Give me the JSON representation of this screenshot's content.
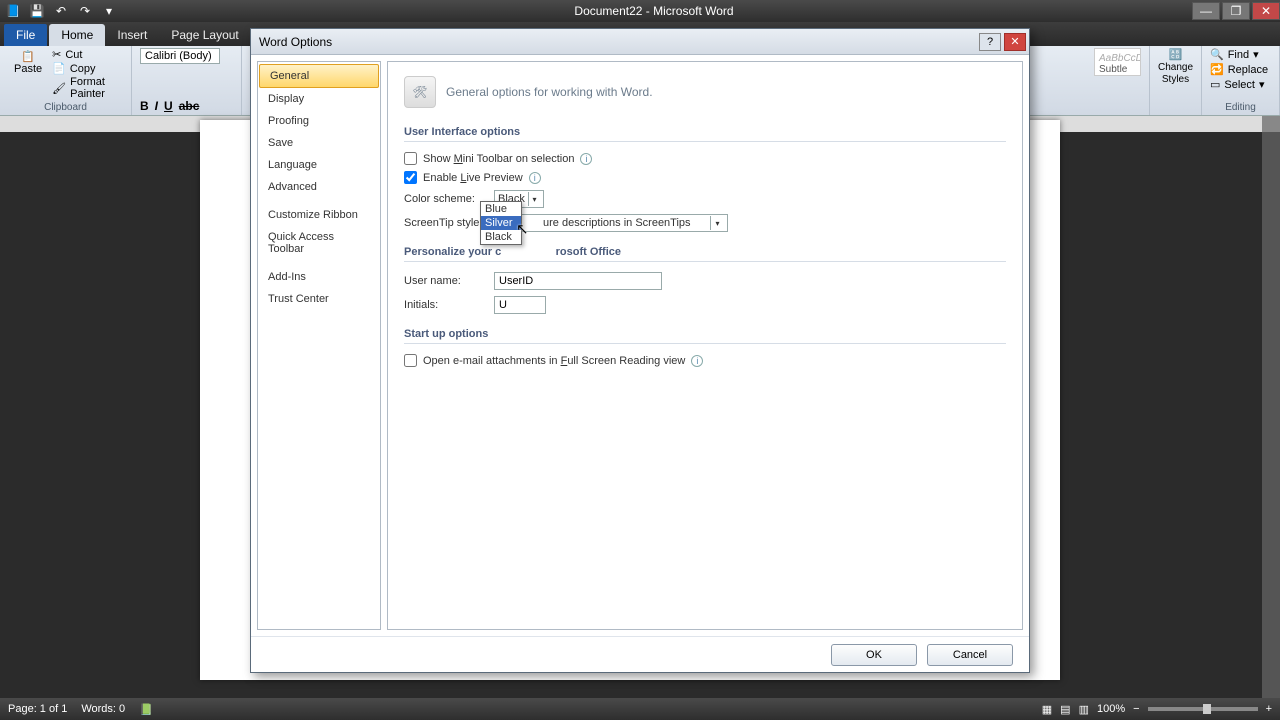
{
  "window": {
    "title": "Document22 - Microsoft Word"
  },
  "tabs": {
    "file": "File",
    "home": "Home",
    "insert": "Insert",
    "page_layout": "Page Layout"
  },
  "ribbon": {
    "clipboard": {
      "paste": "Paste",
      "cut": "Cut",
      "copy": "Copy",
      "format_painter": "Format Painter",
      "label": "Clipboard"
    },
    "font": {
      "name": "Calibri (Body)"
    },
    "styles": {
      "subtle_em": "Subtle Em...",
      "change_styles": "Change Styles"
    },
    "editing": {
      "find": "Find",
      "replace": "Replace",
      "select": "Select",
      "label": "Editing"
    }
  },
  "statusbar": {
    "page": "Page: 1 of 1",
    "words": "Words: 0",
    "zoom": "100%"
  },
  "dialog": {
    "title": "Word Options",
    "nav": [
      "General",
      "Display",
      "Proofing",
      "Save",
      "Language",
      "Advanced",
      "Customize Ribbon",
      "Quick Access Toolbar",
      "Add-Ins",
      "Trust Center"
    ],
    "header": "General options for working with Word.",
    "section_ui": "User Interface options",
    "opt_mini_toolbar": "Show Mini Toolbar on selection",
    "opt_live_preview": "Enable Live Preview",
    "color_scheme_label": "Color scheme:",
    "color_scheme_value": "Black",
    "color_scheme_options": [
      "Blue",
      "Silver",
      "Black"
    ],
    "screentip_label": "ScreenTip style:",
    "screentip_value_fragment": "ure descriptions in ScreenTips",
    "section_personalize": "Personalize your copy of Microsoft Office",
    "user_name_label": "User name:",
    "user_name_value": "UserID",
    "initials_label": "Initials:",
    "initials_value": "U",
    "section_startup": "Start up options",
    "opt_email_attach": "Open e-mail attachments in Full Screen Reading view",
    "ok": "OK",
    "cancel": "Cancel"
  }
}
